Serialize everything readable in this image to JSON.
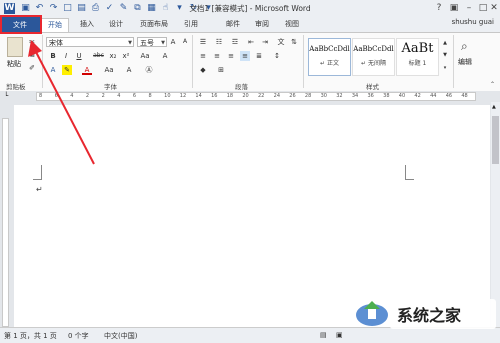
{
  "window": {
    "title": "文档1 [兼容模式] - Microsoft Word",
    "user": "shushu guai"
  },
  "tabs": [
    "文件",
    "开始",
    "插入",
    "设计",
    "页面布局",
    "引用",
    "邮件",
    "审阅",
    "视图"
  ],
  "clipboard": {
    "paste_label": "粘贴",
    "group_label": "剪贴板"
  },
  "font": {
    "name": "宋体",
    "size": "五号",
    "group_label": "字体"
  },
  "paragraph": {
    "group_label": "段落"
  },
  "styles": {
    "items": [
      {
        "sample": "AaBbCcDdl",
        "name": "↵ 正文"
      },
      {
        "sample": "AaBbCcDdl",
        "name": "↵ 无间隔"
      },
      {
        "sample": "AaBt",
        "name": "标题 1"
      }
    ],
    "group_label": "样式"
  },
  "editing": {
    "label": "编辑"
  },
  "ruler": {
    "marks": [
      "8",
      "6",
      "4",
      "2",
      "2",
      "4",
      "6",
      "8",
      "10",
      "12",
      "14",
      "16",
      "18",
      "20",
      "22",
      "24",
      "26",
      "28",
      "30",
      "32",
      "34",
      "36",
      "38",
      "40",
      "42",
      "44",
      "46",
      "48"
    ]
  },
  "status": {
    "page": "第 1 页，共 1 页",
    "words": "0 个字",
    "language": "中文(中国)"
  },
  "watermark": {
    "text": "系统之家"
  },
  "colors": {
    "accent": "#2b579a",
    "highlight": "#e8272f"
  }
}
